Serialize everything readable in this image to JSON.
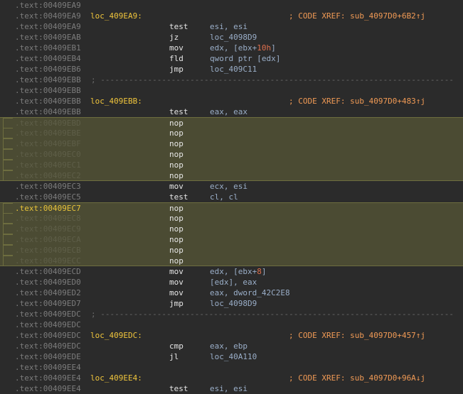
{
  "rows": [
    {
      "addr": ".text:00409EA9",
      "label": "",
      "mnem": "",
      "ops": "",
      "comment": ""
    },
    {
      "addr": ".text:00409EA9",
      "label": "loc_409EA9:",
      "mnem": "",
      "ops": "",
      "comment": "; CODE XREF: sub_4097D0+6B2↑j"
    },
    {
      "addr": ".text:00409EA9",
      "label": "",
      "mnem": "test",
      "ops": "esi, esi",
      "comment": ""
    },
    {
      "addr": ".text:00409EAB",
      "label": "",
      "mnem": "jz",
      "ops": "loc_4098D9",
      "comment": ""
    },
    {
      "addr": ".text:00409EB1",
      "label": "",
      "mnem": "mov",
      "ops": "edx, [ebx+10h]",
      "comment": ""
    },
    {
      "addr": ".text:00409EB4",
      "label": "",
      "mnem": "fld",
      "ops": "qword ptr [edx]",
      "comment": ""
    },
    {
      "addr": ".text:00409EB6",
      "label": "",
      "mnem": "jmp",
      "ops": "loc_409C11",
      "comment": ""
    },
    {
      "addr": ".text:00409EBB",
      "label": "",
      "mnem": "",
      "ops": "",
      "comment": "",
      "separator": true
    },
    {
      "addr": ".text:00409EBB",
      "label": "",
      "mnem": "",
      "ops": "",
      "comment": ""
    },
    {
      "addr": ".text:00409EBB",
      "label": "loc_409EBB:",
      "mnem": "",
      "ops": "",
      "comment": "; CODE XREF: sub_4097D0+483↑j"
    },
    {
      "addr": ".text:00409EBB",
      "label": "",
      "mnem": "test",
      "ops": "eax, eax",
      "comment": ""
    },
    {
      "addr": ".text:00409EBD",
      "label": "",
      "mnem": "nop",
      "ops": "",
      "comment": "",
      "hl": true
    },
    {
      "addr": ".text:00409EBE",
      "label": "",
      "mnem": "nop",
      "ops": "",
      "comment": "",
      "hl": true
    },
    {
      "addr": ".text:00409EBF",
      "label": "",
      "mnem": "nop",
      "ops": "",
      "comment": "",
      "hl": true
    },
    {
      "addr": ".text:00409EC0",
      "label": "",
      "mnem": "nop",
      "ops": "",
      "comment": "",
      "hl": true
    },
    {
      "addr": ".text:00409EC1",
      "label": "",
      "mnem": "nop",
      "ops": "",
      "comment": "",
      "hl": true
    },
    {
      "addr": ".text:00409EC2",
      "label": "",
      "mnem": "nop",
      "ops": "",
      "comment": "",
      "hl": true
    },
    {
      "addr": ".text:00409EC3",
      "label": "",
      "mnem": "mov",
      "ops": "ecx, esi",
      "comment": ""
    },
    {
      "addr": ".text:00409EC5",
      "label": "",
      "mnem": "test",
      "ops": "cl, cl",
      "comment": ""
    },
    {
      "addr": ".text:00409EC7",
      "label": "",
      "mnem": "nop",
      "ops": "",
      "comment": "",
      "hl": true,
      "cur": true
    },
    {
      "addr": ".text:00409EC8",
      "label": "",
      "mnem": "nop",
      "ops": "",
      "comment": "",
      "hl": true
    },
    {
      "addr": ".text:00409EC9",
      "label": "",
      "mnem": "nop",
      "ops": "",
      "comment": "",
      "hl": true
    },
    {
      "addr": ".text:00409ECA",
      "label": "",
      "mnem": "nop",
      "ops": "",
      "comment": "",
      "hl": true
    },
    {
      "addr": ".text:00409ECB",
      "label": "",
      "mnem": "nop",
      "ops": "",
      "comment": "",
      "hl": true
    },
    {
      "addr": ".text:00409ECC",
      "label": "",
      "mnem": "nop",
      "ops": "",
      "comment": "",
      "hl": true
    },
    {
      "addr": ".text:00409ECD",
      "label": "",
      "mnem": "mov",
      "ops": "edx, [ebx+8]",
      "comment": ""
    },
    {
      "addr": ".text:00409ED0",
      "label": "",
      "mnem": "mov",
      "ops": "[edx], eax",
      "comment": ""
    },
    {
      "addr": ".text:00409ED2",
      "label": "",
      "mnem": "mov",
      "ops": "eax, dword_42C2E8",
      "comment": ""
    },
    {
      "addr": ".text:00409ED7",
      "label": "",
      "mnem": "jmp",
      "ops": "loc_4098D9",
      "comment": ""
    },
    {
      "addr": ".text:00409EDC",
      "label": "",
      "mnem": "",
      "ops": "",
      "comment": "",
      "separator": true
    },
    {
      "addr": ".text:00409EDC",
      "label": "",
      "mnem": "",
      "ops": "",
      "comment": ""
    },
    {
      "addr": ".text:00409EDC",
      "label": "loc_409EDC:",
      "mnem": "",
      "ops": "",
      "comment": "; CODE XREF: sub_4097D0+457↑j"
    },
    {
      "addr": ".text:00409EDC",
      "label": "",
      "mnem": "cmp",
      "ops": "eax, ebp",
      "comment": ""
    },
    {
      "addr": ".text:00409EDE",
      "label": "",
      "mnem": "jl",
      "ops": "loc_40A110",
      "comment": ""
    },
    {
      "addr": ".text:00409EE4",
      "label": "",
      "mnem": "",
      "ops": "",
      "comment": ""
    },
    {
      "addr": ".text:00409EE4",
      "label": "loc_409EE4:",
      "mnem": "",
      "ops": "",
      "comment": "; CODE XREF: sub_4097D0+96A↓j"
    },
    {
      "addr": ".text:00409EE4",
      "label": "",
      "mnem": "test",
      "ops": "esi, esi",
      "comment": ""
    }
  ],
  "separator_text": "; ---------------------------------------------------------------------------",
  "colors": {
    "background": "#2b2b2b",
    "highlight": "#4b4b33",
    "label": "#f0c53c",
    "comment": "#f09a55",
    "operand": "#9aaec8",
    "number": "#e0704e"
  }
}
